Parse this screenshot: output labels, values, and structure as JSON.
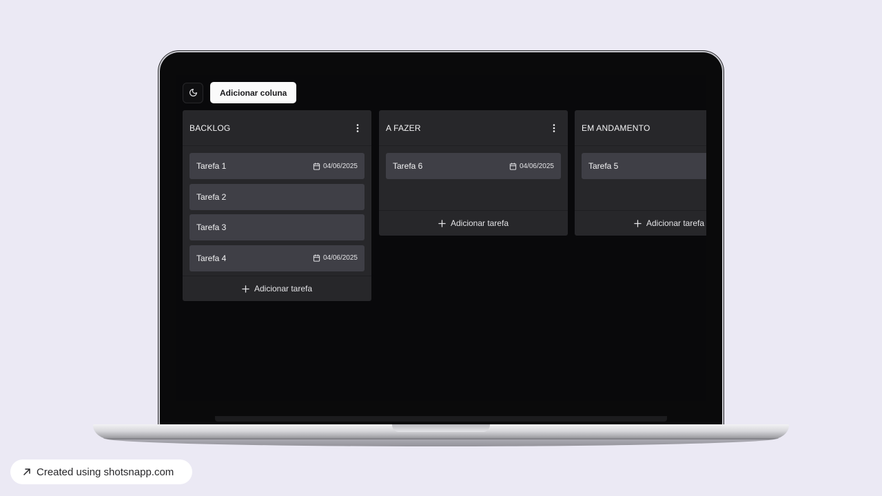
{
  "toolbar": {
    "theme_icon": "moon-icon",
    "add_column_label": "Adicionar coluna"
  },
  "columns": [
    {
      "title": "BACKLOG",
      "cards": [
        {
          "title": "Tarefa 1",
          "date": "04/06/2025"
        },
        {
          "title": "Tarefa 2"
        },
        {
          "title": "Tarefa 3"
        },
        {
          "title": "Tarefa 4",
          "date": "04/06/2025"
        }
      ],
      "add_task_label": "Adicionar tarefa"
    },
    {
      "title": "A FAZER",
      "cards": [
        {
          "title": "Tarefa 6",
          "date": "04/06/2025"
        }
      ],
      "add_task_label": "Adicionar tarefa"
    },
    {
      "title": "EM ANDAMENTO",
      "cards": [
        {
          "title": "Tarefa 5"
        }
      ],
      "add_task_label": "Adicionar tarefa"
    }
  ],
  "footer": {
    "credit_text": "Created using shotsnapp.com",
    "credit_icon": "arrow-up-right-icon"
  },
  "colors": {
    "page_background": "#ebe9f4",
    "screen_background": "#09090b",
    "column_background": "#27272a",
    "card_background": "#3f3f46",
    "primary_button": "#fafafa"
  }
}
